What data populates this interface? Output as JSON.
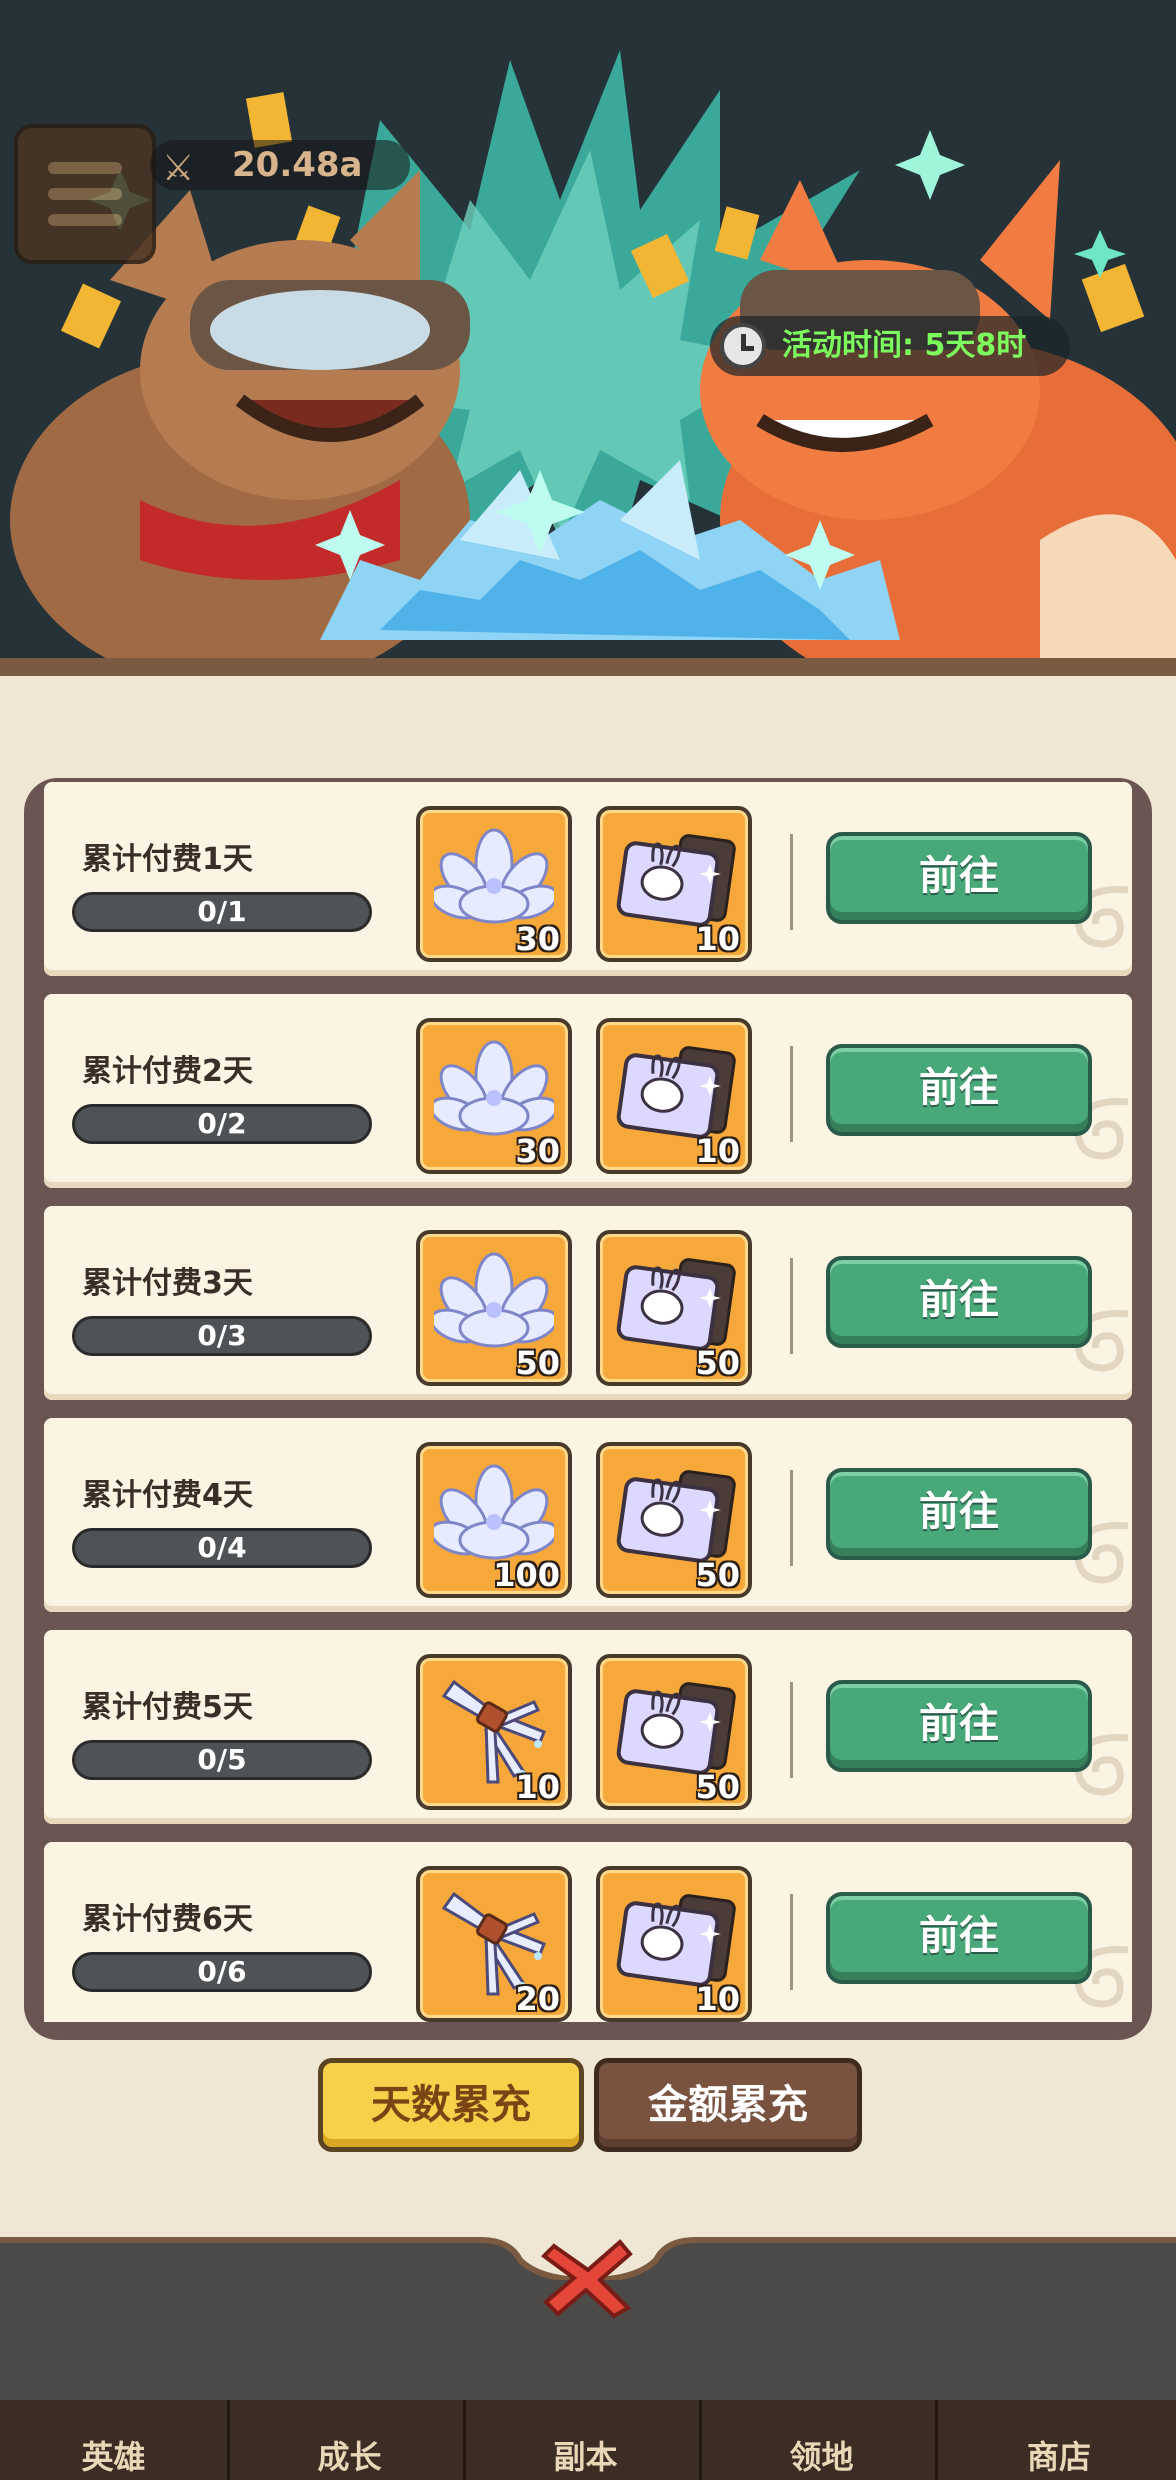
{
  "header": {
    "power_value": "20.48a",
    "timer_label": "活动时间:",
    "timer_value": "5天8时"
  },
  "rows": [
    {
      "title": "累计付费1天",
      "progress": "0/1",
      "rewards": [
        {
          "icon": "lotus-icon",
          "qty": "30"
        },
        {
          "icon": "rabbit-ticket-icon",
          "qty": "10"
        }
      ],
      "button": "前往"
    },
    {
      "title": "累计付费2天",
      "progress": "0/2",
      "rewards": [
        {
          "icon": "lotus-icon",
          "qty": "30"
        },
        {
          "icon": "rabbit-ticket-icon",
          "qty": "10"
        }
      ],
      "button": "前往"
    },
    {
      "title": "累计付费3天",
      "progress": "0/3",
      "rewards": [
        {
          "icon": "lotus-icon",
          "qty": "50"
        },
        {
          "icon": "rabbit-ticket-icon",
          "qty": "50"
        }
      ],
      "button": "前往"
    },
    {
      "title": "累计付费4天",
      "progress": "0/4",
      "rewards": [
        {
          "icon": "lotus-icon",
          "qty": "100"
        },
        {
          "icon": "rabbit-ticket-icon",
          "qty": "50"
        }
      ],
      "button": "前往"
    },
    {
      "title": "累计付费5天",
      "progress": "0/5",
      "rewards": [
        {
          "icon": "crystal-root-icon",
          "qty": "10"
        },
        {
          "icon": "rabbit-ticket-icon",
          "qty": "50"
        }
      ],
      "button": "前往"
    },
    {
      "title": "累计付费6天",
      "progress": "0/6",
      "rewards": [
        {
          "icon": "crystal-root-icon",
          "qty": "20"
        },
        {
          "icon": "rabbit-ticket-icon",
          "qty": "10"
        }
      ],
      "button": "前往"
    }
  ],
  "tabs": {
    "days": "天数累充",
    "amount": "金额累充"
  },
  "nav": [
    "英雄",
    "成长",
    "副本",
    "领地",
    "商店"
  ],
  "colors": {
    "accent_green": "#48a878",
    "timer_green": "#7dfc5e",
    "tab_active": "#f5d24a",
    "tab_inactive": "#7a5340",
    "item_bg": "#f6a83a",
    "close_red": "#e5463a"
  }
}
